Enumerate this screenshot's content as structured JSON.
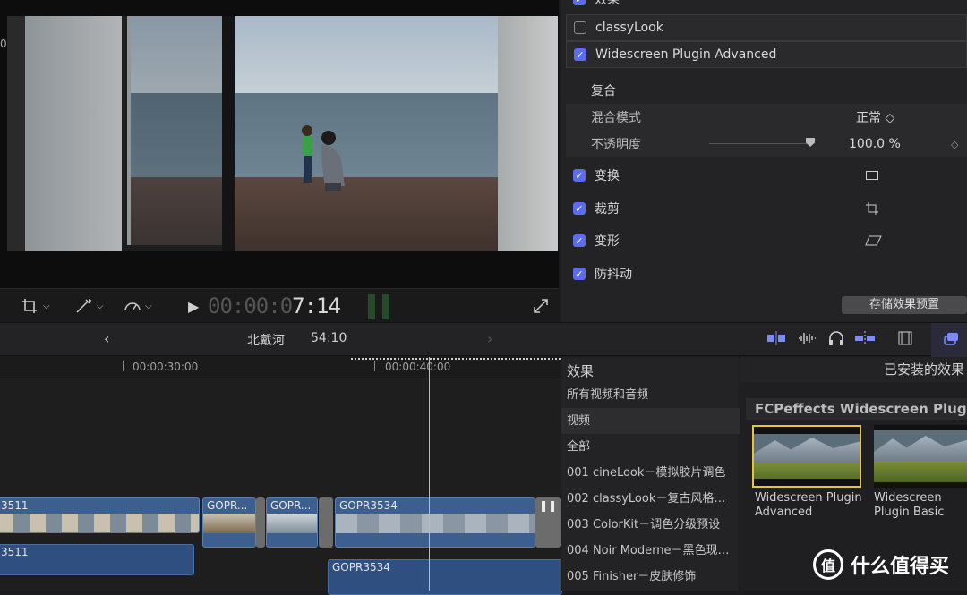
{
  "viewer": {
    "timecode_dim": "00:00:0",
    "timecode_bright": "7:14",
    "side_marker": "0"
  },
  "inspector": {
    "section_effects": "效果",
    "effects": [
      {
        "label": "classyLook",
        "checked": false
      },
      {
        "label": "Widescreen Plugin Advanced",
        "checked": true
      }
    ],
    "composite_header": "复合",
    "blend_mode_label": "混合模式",
    "blend_mode_value": "正常 ◇",
    "opacity_label": "不透明度",
    "opacity_value": "100.0 %",
    "opacity_fraction": 1.0,
    "sections": [
      {
        "label": "变换",
        "checked": true
      },
      {
        "label": "裁剪",
        "checked": true
      },
      {
        "label": "变形",
        "checked": true
      },
      {
        "label": "防抖动",
        "checked": true
      }
    ],
    "save_button": "存储效果预置"
  },
  "timeline_header": {
    "back_icon": "chevron-left-icon",
    "project_name": "北戴河",
    "duration": "54:10",
    "forward_icon": "chevron-right-icon"
  },
  "timeline": {
    "ruler": [
      "00:00:30:00",
      "00:00:40:00"
    ],
    "clips": [
      "3511",
      "GOPR...",
      "GOPR...",
      "GOPR3534"
    ],
    "audio_clips": [
      "3511",
      "GOPR3534"
    ]
  },
  "effects_browser": {
    "title": "效果",
    "items": [
      "所有视频和音频",
      "视频",
      "全部",
      "001 cineLook－模拟胶片调色",
      "002 classyLook－复古风格…",
      "003 ColorKit－调色分级预设",
      "004 Noir Moderne－黑色现…",
      "005 Finisher－皮肤修饰"
    ],
    "selected_index": 1,
    "grid_title": "已安装的效果",
    "category": "FCPeffects Widescreen Plugin",
    "effects": [
      {
        "name": "Widescreen Plugin Advanced",
        "selected": true
      },
      {
        "name": "Widescreen Plugin Basic",
        "selected": false
      }
    ]
  },
  "watermark": {
    "badge": "值",
    "text": "什么值得买"
  },
  "colors": {
    "accent": "#5b6cf0",
    "clip": "#3c5f8f",
    "selection": "#e6c53a"
  }
}
